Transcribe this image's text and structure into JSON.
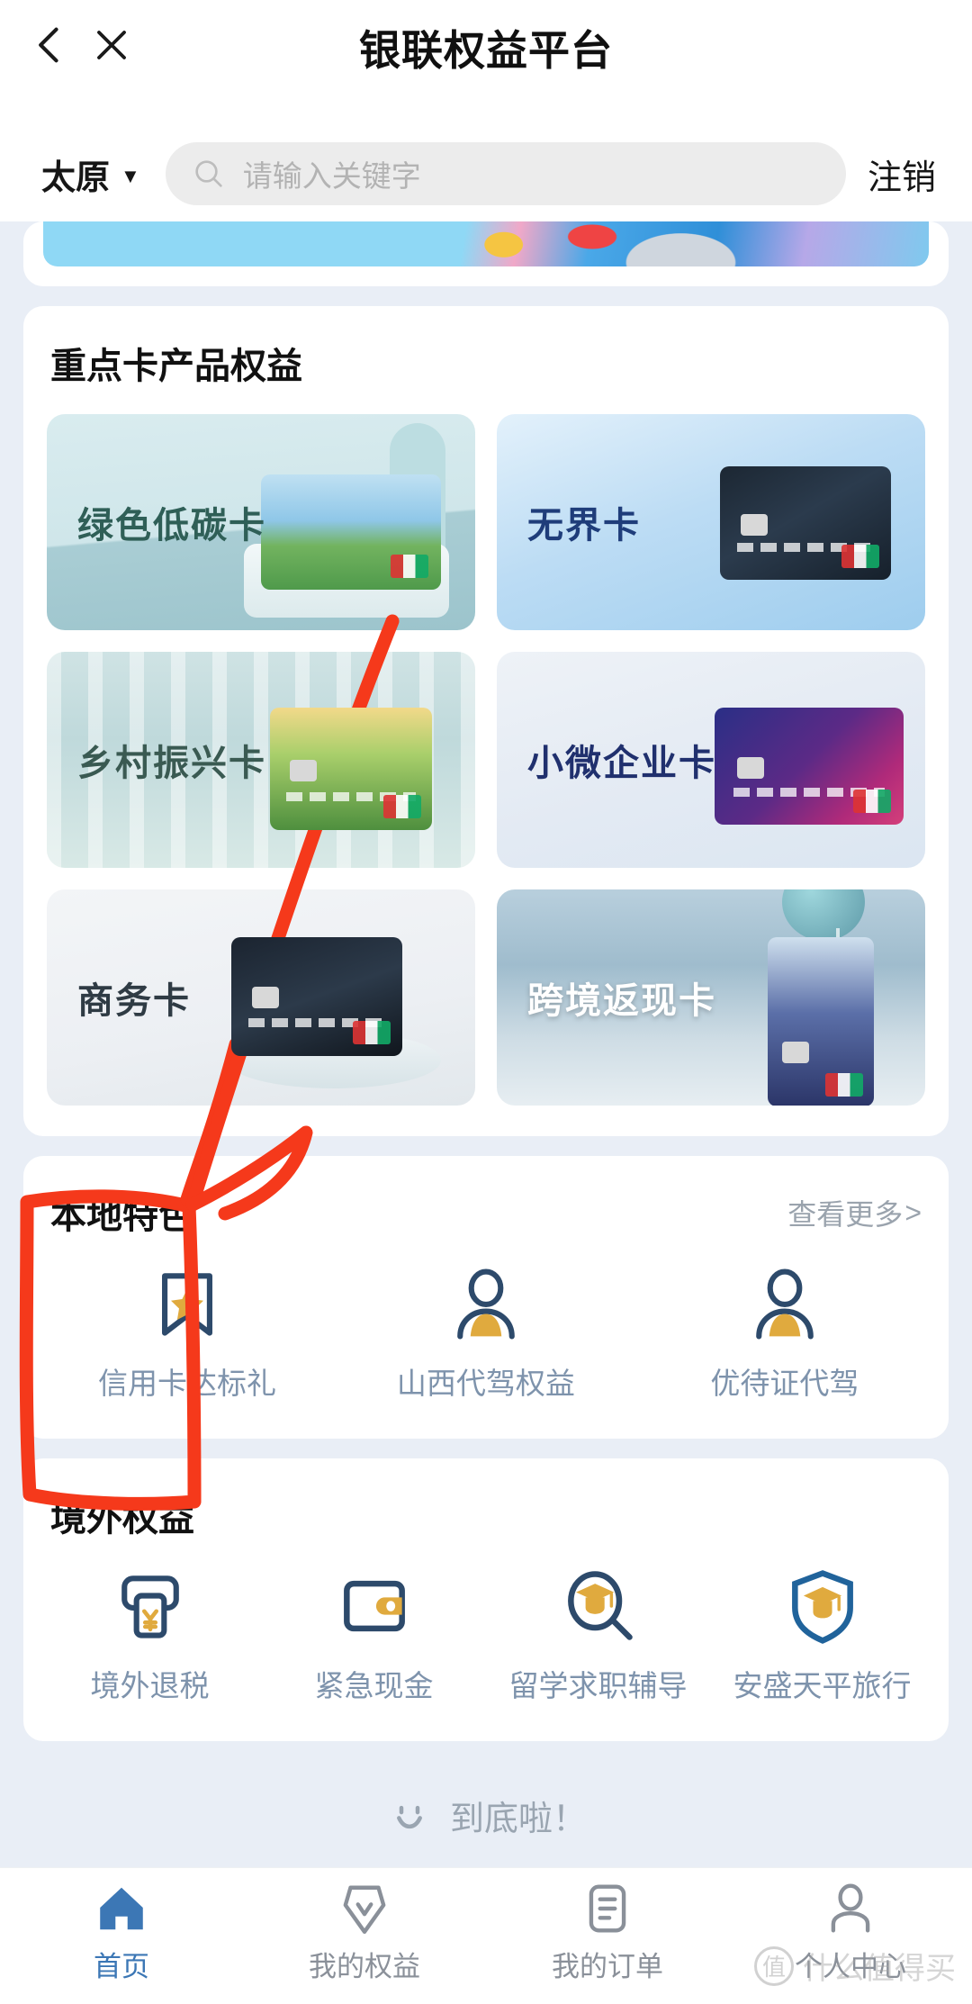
{
  "header": {
    "back_icon": "chevron-left-icon",
    "close_icon": "close-icon",
    "title": "银联权益平台"
  },
  "search": {
    "city": "太原",
    "city_chevron": "chevron-down-icon",
    "search_icon": "search-icon",
    "placeholder": "请输入关键字",
    "logout_label": "注销"
  },
  "sections": {
    "card_products": {
      "title": "重点卡产品权益",
      "tiles": [
        {
          "label": "绿色低碳卡",
          "skin": "sk-green"
        },
        {
          "label": "无界卡",
          "skin": "sk-wujie"
        },
        {
          "label": "乡村振兴卡",
          "skin": "sk-xiang"
        },
        {
          "label": "小微企业卡",
          "skin": "sk-weiqi"
        },
        {
          "label": "商务卡",
          "skin": "sk-shang"
        },
        {
          "label": "跨境返现卡",
          "skin": "sk-kua"
        }
      ]
    },
    "local": {
      "title": "本地特色",
      "more_label": "查看更多",
      "more_chevron": ">",
      "items": [
        {
          "label": "信用卡达标礼",
          "icon": "bookmark-star-icon"
        },
        {
          "label": "山西代驾权益",
          "icon": "person-icon"
        },
        {
          "label": "优待证代驾",
          "icon": "person-icon"
        }
      ]
    },
    "overseas": {
      "title": "境外权益",
      "items": [
        {
          "label": "境外退税",
          "icon": "atm-yen-icon"
        },
        {
          "label": "紧急现金",
          "icon": "wallet-icon"
        },
        {
          "label": "留学求职辅导",
          "icon": "magnifier-graduation-cap-icon"
        },
        {
          "label": "安盛天平旅行",
          "icon": "shield-graduation-cap-icon"
        }
      ]
    }
  },
  "end_of_list": {
    "smiley_icon": "smiley-icon",
    "text": "到底啦！"
  },
  "tabbar": {
    "tabs": [
      {
        "label": "首页",
        "icon": "home-icon",
        "active": true
      },
      {
        "label": "我的权益",
        "icon": "diamond-check-icon",
        "active": false
      },
      {
        "label": "我的订单",
        "icon": "order-list-icon",
        "active": false
      },
      {
        "label": "个人中心",
        "icon": "person-outline-icon",
        "active": false
      }
    ]
  },
  "watermark": {
    "logo_text": "值",
    "text": "什么值得买"
  },
  "annotation": {
    "color": "#f5391b",
    "shape": "hand-drawn-rectangle-with-arrow",
    "target": "信用卡达标礼"
  },
  "colors": {
    "page_bg": "#e9eef6",
    "card_bg": "#ffffff",
    "icon_outline": "#2d4a6b",
    "icon_accent": "#e0aa3e",
    "label_muted": "#7e93ac",
    "tab_active": "#3c77b5",
    "annotation_red": "#f5391b"
  }
}
